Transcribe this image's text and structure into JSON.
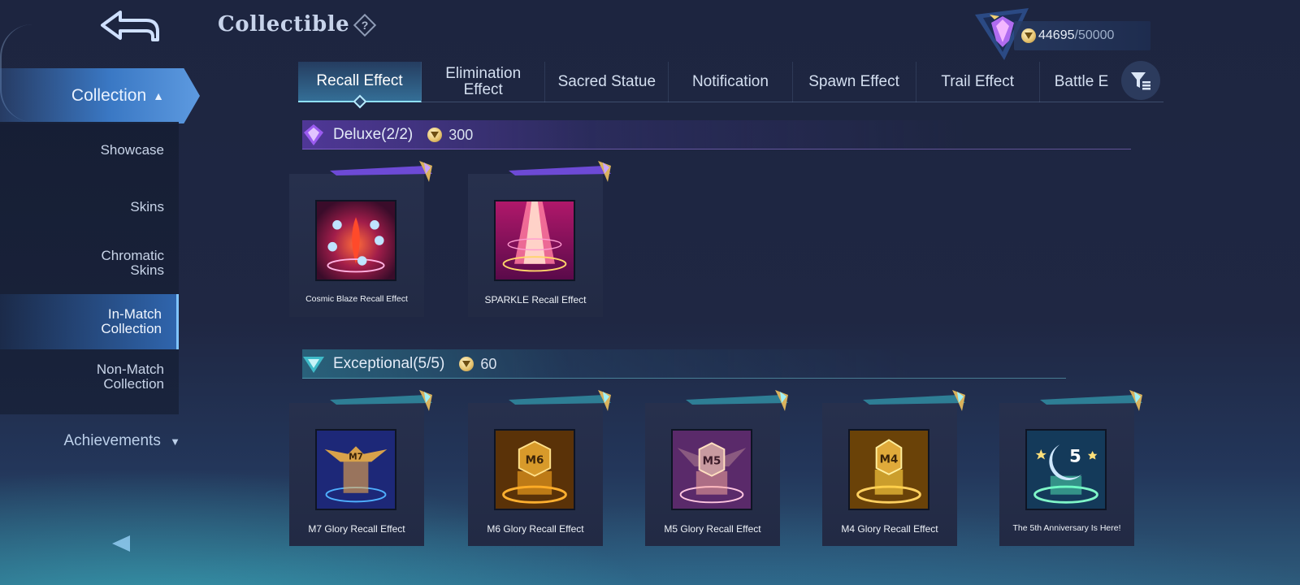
{
  "header": {
    "title": "Collectible",
    "help_icon": "question-diamond-icon",
    "points_current": "44695",
    "points_total": "/50000"
  },
  "sidebar": {
    "collection_label": "Collection",
    "items": [
      {
        "label": "Showcase",
        "active": false
      },
      {
        "label": "Skins",
        "active": false
      },
      {
        "label": "Chromatic Skins",
        "active": false
      },
      {
        "label": "In-Match Collection",
        "active": true
      },
      {
        "label": "Non-Match Collection",
        "active": false
      }
    ],
    "achievements_label": "Achievements"
  },
  "tabs": [
    {
      "label": "Recall Effect",
      "active": true
    },
    {
      "label": "Elimination Effect",
      "active": false
    },
    {
      "label": "Sacred Statue",
      "active": false
    },
    {
      "label": "Notification",
      "active": false
    },
    {
      "label": "Spawn Effect",
      "active": false
    },
    {
      "label": "Trail Effect",
      "active": false
    },
    {
      "label": "Battle E",
      "active": false
    }
  ],
  "sections": {
    "deluxe": {
      "title": "Deluxe",
      "count": "(2/2)",
      "cost": "300",
      "items": [
        {
          "name": "Cosmic Blaze Recall Effect"
        },
        {
          "name": "SPARKLE Recall Effect"
        }
      ]
    },
    "exceptional": {
      "title": "Exceptional",
      "count": "(5/5)",
      "cost": "60",
      "items": [
        {
          "name": "M7 Glory Recall Effect",
          "badge": "M7"
        },
        {
          "name": "M6 Glory Recall Effect",
          "badge": "M6"
        },
        {
          "name": "M5 Glory Recall Effect",
          "badge": "M5"
        },
        {
          "name": "M4 Glory Recall Effect",
          "badge": "M4"
        },
        {
          "name": "The 5th Anniversary Is Here!",
          "badge": "5"
        }
      ]
    }
  },
  "colors": {
    "accent": "#3a78c4",
    "deluxe": "#8b5cf6",
    "exceptional": "#3fbac8",
    "coin": "#e8c774"
  }
}
